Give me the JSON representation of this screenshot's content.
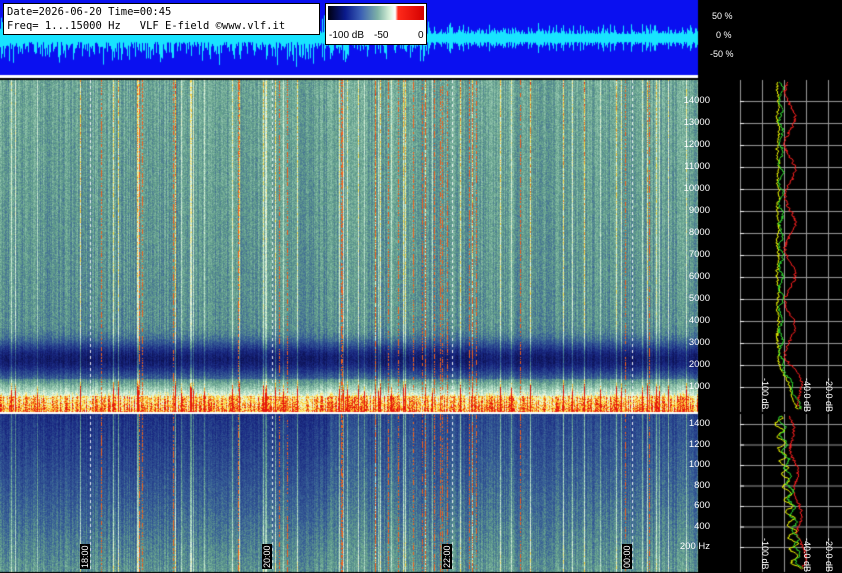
{
  "header": {
    "line1": "Date=2026-06-20 Time=00:45",
    "line2": "Freq= 1...15000 Hz   VLF E-field ©www.vlf.it"
  },
  "color_scale": {
    "label_min": "-100 dB",
    "label_mid": "-50",
    "label_max": "0",
    "colors": [
      "#000010",
      "#0a1a8c",
      "#3b5fb5",
      "#7fb3a6",
      "#d6efd8",
      "#ffffff",
      "#ff2a1a",
      "#d40000"
    ]
  },
  "waveform_scale": {
    "top": "50 %",
    "mid": "0 %",
    "bottom": "-50 %"
  },
  "upper_freq_labels": [
    "14000",
    "13000",
    "12000",
    "11000",
    "10000",
    "9000",
    "8000",
    "7000",
    "6000",
    "5000",
    "4000",
    "3000",
    "2000",
    "1000"
  ],
  "lower_freq_labels": [
    "1400",
    "1200",
    "1000",
    "800",
    "600",
    "400",
    "200 Hz"
  ],
  "time_labels": [
    "18:00",
    "20:00",
    "22:00",
    "00:00"
  ],
  "upper_db_labels": [
    "-100 dB",
    "-40.0 dB",
    "-20.0 dB"
  ],
  "lower_db_labels": [
    "-100 dB",
    "-40.0 dB",
    "-20.0 dB"
  ],
  "colors": {
    "waveform_bg": "#0a10f0",
    "waveform_trace": "#18e4ff",
    "spectrum_avg": "#f4ff00",
    "spectrum_peak": "#ff2020",
    "spectrum_green": "#30e030"
  }
}
